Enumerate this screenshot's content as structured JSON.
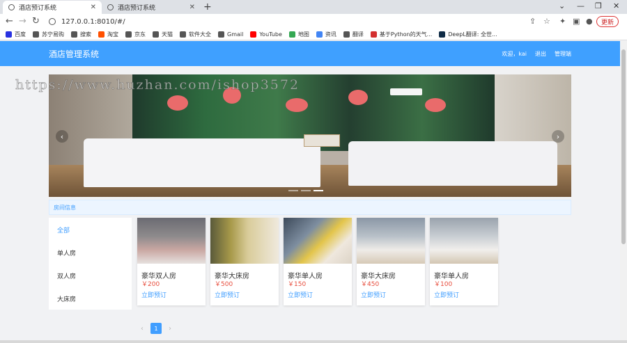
{
  "browser": {
    "tabs": [
      {
        "title": "酒店预订系统"
      },
      {
        "title": "酒店预订系统"
      }
    ],
    "url": "127.0.0.1:8010/#/",
    "update_label": "更新",
    "bookmarks": [
      {
        "label": "百度",
        "color": "#2932e1"
      },
      {
        "label": "苏宁易购",
        "color": "#555555"
      },
      {
        "label": "搜索",
        "color": "#555555"
      },
      {
        "label": "淘宝",
        "color": "#ff5000"
      },
      {
        "label": "京东",
        "color": "#555555"
      },
      {
        "label": "天猫",
        "color": "#555555"
      },
      {
        "label": "软件大全",
        "color": "#555555"
      },
      {
        "label": "Gmail",
        "color": "#555555"
      },
      {
        "label": "YouTube",
        "color": "#ff0000"
      },
      {
        "label": "地图",
        "color": "#34a853"
      },
      {
        "label": "资讯",
        "color": "#4285f4"
      },
      {
        "label": "翻译",
        "color": "#555555"
      },
      {
        "label": "基于Python的天气...",
        "color": "#d32f2f"
      },
      {
        "label": "DeepL翻译: 全世...",
        "color": "#0f2b46"
      }
    ]
  },
  "header": {
    "brand": "酒店管理系统",
    "welcome": "欢迎，kai",
    "logout": "退出",
    "admin": "管理端"
  },
  "watermark": "https://www.huzhan.com/ishop3572",
  "section_title": "房间信息",
  "categories": [
    "全部",
    "单人房",
    "双人房",
    "大床房"
  ],
  "rooms": [
    {
      "name": "豪华双人房",
      "price": "￥200",
      "book": "立即预订"
    },
    {
      "name": "豪华大床房",
      "price": "￥500",
      "book": "立即预订"
    },
    {
      "name": "豪华单人房",
      "price": "￥150",
      "book": "立即预订"
    },
    {
      "name": "豪华大床房",
      "price": "￥450",
      "book": "立即预订"
    },
    {
      "name": "豪华单人房",
      "price": "￥100",
      "book": "立即预订"
    }
  ],
  "pagination": {
    "current": "1"
  },
  "colors": {
    "header": "#3fa0ff",
    "accent": "#409eff",
    "price": "#e74c3c"
  }
}
